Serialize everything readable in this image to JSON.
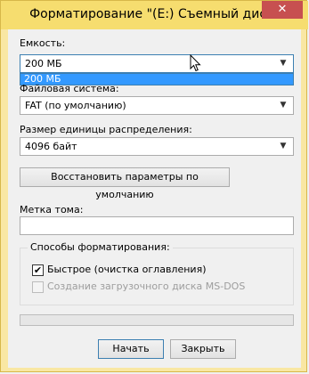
{
  "window": {
    "title": "Форматирование \"(E:) Съемный диск\"",
    "close_glyph": "✕",
    "accent_color": "#f6dd6f",
    "close_color": "#c75050"
  },
  "capacity": {
    "label": "Емкость:",
    "value": "200 МБ",
    "dropdown_options": [
      "200 МБ"
    ]
  },
  "filesystem": {
    "label": "Файловая система:",
    "value": "FAT (по умолчанию)"
  },
  "allocation": {
    "label": "Размер единицы распределения:",
    "value": "4096 байт"
  },
  "restore_defaults_label": "Восстановить параметры по умолчанию",
  "volume_label": {
    "label": "Метка тома:",
    "value": ""
  },
  "format_options": {
    "legend": "Способы форматирования:",
    "quick": {
      "label": "Быстрое (очистка оглавления)",
      "checked": true,
      "check_glyph": "✔"
    },
    "msdos": {
      "label": "Создание загрузочного диска MS-DOS",
      "checked": false,
      "disabled": true
    }
  },
  "progress": {
    "value": 0
  },
  "buttons": {
    "start": "Начать",
    "close": "Закрыть"
  },
  "dropdown_arrow_glyph": "▼"
}
